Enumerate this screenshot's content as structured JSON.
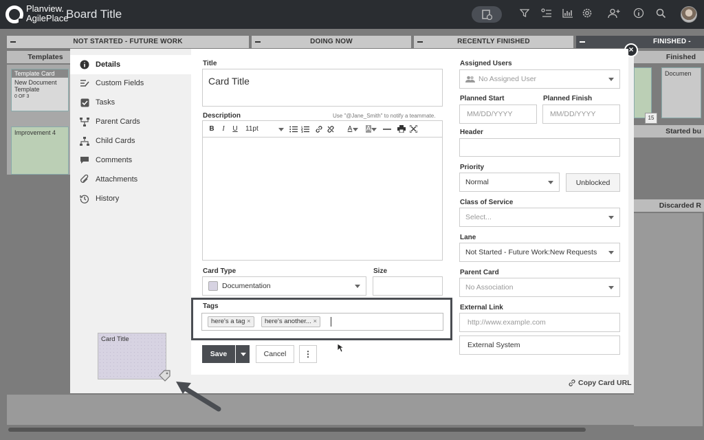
{
  "app": {
    "logo_line1": "Planview.",
    "logo_line2": "AgilePlace",
    "board_title": "Board Title"
  },
  "icons": {
    "top": [
      "card-add-icon",
      "filter-icon",
      "list-icon",
      "chart-icon",
      "gear-icon",
      "add-user-icon",
      "info-icon",
      "search-icon",
      "avatar"
    ]
  },
  "board": {
    "columns": [
      "NOT STARTED - FUTURE WORK",
      "DOING NOW",
      "RECENTLY FINISHED",
      "FINISHED -"
    ],
    "sub_headers": [
      "Templates",
      "Finished",
      "Started bu",
      "Discarded R"
    ],
    "cards": {
      "template_header": "Template Card",
      "template_body": "New Document Template",
      "template_progress": "0 OF 3",
      "improvement": "Improvement 4",
      "document": "Documen",
      "date_badge": "15"
    }
  },
  "modal": {
    "nav": [
      {
        "label": "Details",
        "icon": "info-icon"
      },
      {
        "label": "Custom Fields",
        "icon": "custom-fields-icon"
      },
      {
        "label": "Tasks",
        "icon": "checkbox-icon"
      },
      {
        "label": "Parent Cards",
        "icon": "parent-cards-icon"
      },
      {
        "label": "Child Cards",
        "icon": "child-cards-icon"
      },
      {
        "label": "Comments",
        "icon": "comment-icon"
      },
      {
        "label": "Attachments",
        "icon": "paperclip-icon"
      },
      {
        "label": "History",
        "icon": "history-icon"
      }
    ],
    "title_label": "Title",
    "title_value": "Card Title",
    "description_label": "Description",
    "description_hint": "Use \"@Jane_Smith\" to notify a teammate.",
    "toolbar": {
      "font_size": "11pt"
    },
    "card_type_label": "Card Type",
    "card_type_value": "Documentation",
    "size_label": "Size",
    "tags_label": "Tags",
    "tags": [
      "here's a tag",
      "here's another..."
    ],
    "tag_remove": "×",
    "save_label": "Save",
    "cancel_label": "Cancel",
    "more_label": "⋮",
    "assigned_users_label": "Assigned Users",
    "assigned_users_value": "No Assigned User",
    "planned_start_label": "Planned Start",
    "planned_start_placeholder": "MM/DD/YYYY",
    "planned_finish_label": "Planned Finish",
    "planned_finish_placeholder": "MM/DD/YYYY",
    "header_label": "Header",
    "priority_label": "Priority",
    "priority_value": "Normal",
    "blocked_button": "Unblocked",
    "class_of_service_label": "Class of Service",
    "class_of_service_placeholder": "Select...",
    "lane_label": "Lane",
    "lane_value": "Not Started - Future Work:New Requests",
    "parent_card_label": "Parent Card",
    "parent_card_value": "No Association",
    "external_link_label": "External Link",
    "external_link_placeholder": "http://www.example.com",
    "external_system_value": "External System",
    "copy_url_label": "Copy Card URL",
    "close_glyph": "×",
    "preview_card_title": "Card Title"
  },
  "colors": {
    "topbar": "#2a2d31",
    "accent_dark": "#4a4d52",
    "card_green": "#bbcfb5",
    "preview_card": "#d7d3e2"
  }
}
